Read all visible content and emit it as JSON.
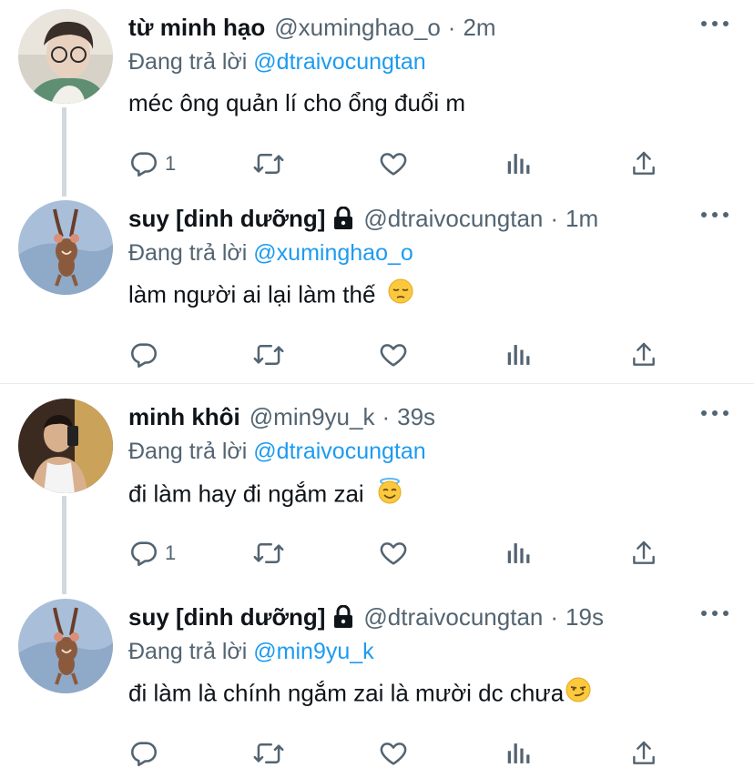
{
  "tweets": [
    {
      "name": "từ minh hạo",
      "handle": "@xuminghao_o",
      "time": "2m",
      "replying_prefix": "Đang trả lời",
      "replying_to": "@dtraivocungtan",
      "text": "méc ông quản lí cho ổng đuổi m",
      "reply_count": "1",
      "locked": false,
      "emoji": ""
    },
    {
      "name": "suy [dinh dưỡng]",
      "handle": "@dtraivocungtan",
      "time": "1m",
      "replying_prefix": "Đang trả lời",
      "replying_to": "@xuminghao_o",
      "text": "làm người ai lại làm thế",
      "reply_count": "",
      "locked": true,
      "emoji": "pensive-face"
    },
    {
      "name": "minh khôi",
      "handle": "@min9yu_k",
      "time": "39s",
      "replying_prefix": "Đang trả lời",
      "replying_to": "@dtraivocungtan",
      "text": "đi làm hay đi ngắm zai",
      "reply_count": "1",
      "locked": false,
      "emoji": "smiling-face-with-halo"
    },
    {
      "name": "suy [dinh dưỡng]",
      "handle": "@dtraivocungtan",
      "time": "19s",
      "replying_prefix": "Đang trả lời",
      "replying_to": "@min9yu_k",
      "text": "đi làm là chính ngắm zai là mười dc chưa",
      "reply_count": "",
      "locked": true,
      "emoji": "smirking-face"
    }
  ],
  "separator": "·",
  "colors": {
    "text_primary": "#0f1419",
    "text_secondary": "#536471",
    "link": "#1d9bf0",
    "thread_line": "#cfd9de",
    "divider": "#e6ecf0"
  },
  "icons": {
    "reply": "reply-icon",
    "retweet": "retweet-icon",
    "like": "heart-icon",
    "views": "views-icon",
    "share": "share-icon",
    "more": "more-icon",
    "lock": "lock-icon"
  }
}
